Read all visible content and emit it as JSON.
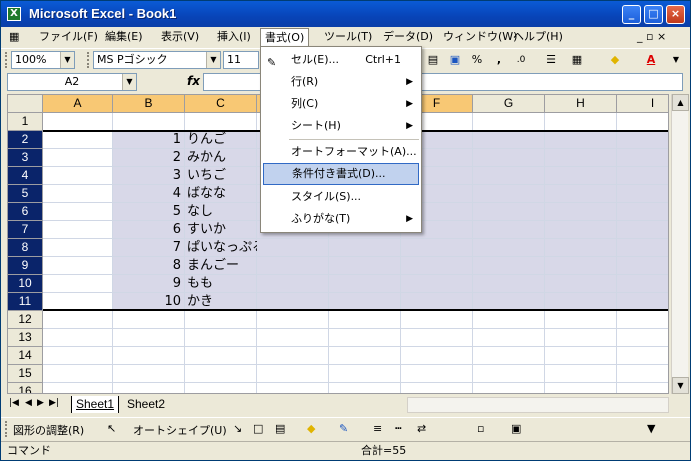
{
  "window": {
    "title": "Microsoft Excel - Book1",
    "minimize": "_",
    "maximize": "□",
    "close": "×"
  },
  "menubar": {
    "items": [
      "ファイル(F)",
      "編集(E)",
      "表示(V)",
      "挿入(I)",
      "書式(O)",
      "ツール(T)",
      "データ(D)",
      "ウィンドウ(W)",
      "ヘルプ(H)"
    ],
    "doc_controls": "_ ▫ ×"
  },
  "toolbar": {
    "zoom": "100%",
    "font_name": "MS Pゴシック",
    "font_size": "11",
    "percent": "%",
    "comma": ",",
    "decimal": ".0"
  },
  "formula_bar": {
    "name_box": "A2",
    "fx": "fx",
    "value": ""
  },
  "grid": {
    "columns": [
      "A",
      "B",
      "C",
      "D",
      "E",
      "F",
      "G",
      "H",
      "I"
    ],
    "rows": [
      "1",
      "2",
      "3",
      "4",
      "5",
      "6",
      "7",
      "8",
      "9",
      "10",
      "11",
      "12",
      "13",
      "14",
      "15",
      "16"
    ],
    "data": [
      {
        "n": "1",
        "t": "りんご"
      },
      {
        "n": "2",
        "t": "みかん"
      },
      {
        "n": "3",
        "t": "いちご"
      },
      {
        "n": "4",
        "t": "ばなな"
      },
      {
        "n": "5",
        "t": "なし"
      },
      {
        "n": "6",
        "t": "すいか"
      },
      {
        "n": "7",
        "t": "ぱいなっぷる"
      },
      {
        "n": "8",
        "t": "まんごー"
      },
      {
        "n": "9",
        "t": "もも"
      },
      {
        "n": "10",
        "t": "かき"
      }
    ]
  },
  "sheets": {
    "tab1": "Sheet1",
    "tab2": "Sheet2"
  },
  "drawing_toolbar": {
    "draw": "図形の調整(R)",
    "autoshape": "オートシェイプ(U)"
  },
  "status": {
    "mode": "コマンド",
    "sum": "合計=55"
  },
  "format_menu": {
    "items": [
      {
        "label": "セル(E)...",
        "shortcut": "Ctrl+1"
      },
      {
        "label": "行(R)"
      },
      {
        "label": "列(C)"
      },
      {
        "label": "シート(H)"
      },
      {
        "label": "オートフォーマット(A)..."
      },
      {
        "label": "条件付き書式(D)..."
      },
      {
        "label": "スタイル(S)..."
      },
      {
        "label": "ふりがな(T)"
      }
    ]
  }
}
